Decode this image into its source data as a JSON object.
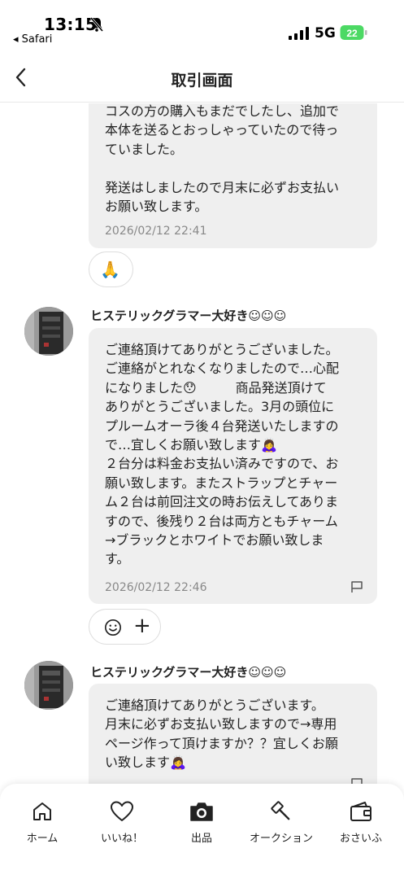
{
  "status_bar": {
    "time": "13:15",
    "back_app": "◂ Safari",
    "network": "5G",
    "battery": "22"
  },
  "header": {
    "title": "取引画面"
  },
  "messages": [
    {
      "text": "コスの方の購入もまだでしたし、追加で\n本体を送るとおっしゃっていたので待っ\nていました。\n\n発送はしましたので月末に必ずお支払い\nお願い致します。",
      "timestamp": "2026/02/12 22:41",
      "reaction": "🙏"
    },
    {
      "sender": "ヒステリックグラマー大好き☺︎☺︎☺︎",
      "text": "ご連絡頂けてありがとうございました。\nご連絡がとれなくなりましたので…心配\nになりました😯　　　商品発送頂けて\nありがとうございました。3月の頭位に\nプルームオーラ後４台発送いたしますの\nで…宜しくお願い致します🙇‍♀️\n２台分は料金お支払い済みですので、お\n願い致します。またストラップとチャー\nム２台は前回注文の時お伝えしてありま\nすので、後残り２台は両方ともチャーム\n→ブラックとホワイトでお願い致しま\nす。",
      "timestamp": "2026/02/12 22:46"
    },
    {
      "sender": "ヒステリックグラマー大好き☺︎☺︎☺︎",
      "text": "ご連絡頂けてありがとうございます。\n月末に必ずお支払い致しますので→専用\nページ作って頂けますか？？宜しくお願\nい致します🙇‍♀️"
    }
  ],
  "reaction_bar": {
    "add": "+"
  },
  "tabbar": {
    "items": [
      {
        "label": "ホーム",
        "icon": "home-icon"
      },
      {
        "label": "いいね！",
        "icon": "heart-icon"
      },
      {
        "label": "出品",
        "icon": "camera-icon"
      },
      {
        "label": "オークション",
        "icon": "gavel-icon"
      },
      {
        "label": "おさいふ",
        "icon": "wallet-icon"
      }
    ]
  }
}
